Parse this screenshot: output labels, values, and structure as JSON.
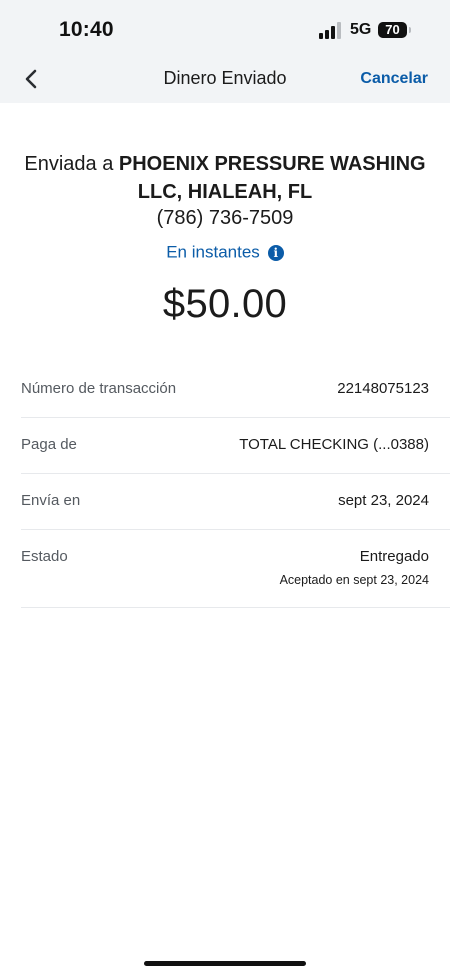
{
  "status_bar": {
    "time": "10:40",
    "network": "5G",
    "battery": "70",
    "signal_bars_active": 3,
    "signal_bars_total": 4
  },
  "nav": {
    "back_icon": "chevron-left-icon",
    "title": "Dinero Enviado",
    "cancel_label": "Cancelar"
  },
  "transfer": {
    "recipient_prefix": "Enviada a ",
    "recipient_name": "PHOENIX PRESSURE WASHING LLC, HIALEAH, FL",
    "phone": "(786) 736-7509",
    "speed_label": "En instantes",
    "speed_icon": "info-icon",
    "amount": "$50.00"
  },
  "details": [
    {
      "label": "Número de transacción",
      "value": "22148075123"
    },
    {
      "label": "Paga de",
      "value": "TOTAL CHECKING (...0388)"
    },
    {
      "label": "Envía en",
      "value": "sept 23, 2024"
    },
    {
      "label": "Estado",
      "value": "Entregado",
      "subvalue": "Aceptado en sept 23, 2024"
    }
  ],
  "colors": {
    "accent": "#0b5ca8",
    "header_bg": "#f2f4f6",
    "divider": "#e7e9ec",
    "label_text": "#555a60"
  }
}
